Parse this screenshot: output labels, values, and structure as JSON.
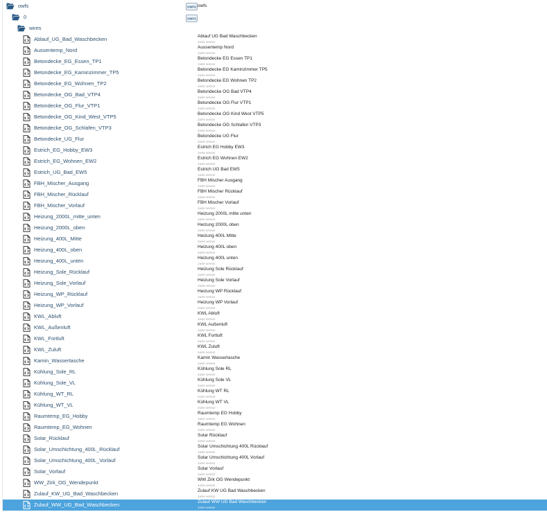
{
  "tree": {
    "root": {
      "label": "owfs",
      "description": "owfs",
      "logo_text": "OWFS"
    },
    "bus": {
      "label": "0",
      "logo_text": "OWFS"
    },
    "folder": {
      "label": "wires"
    },
    "sensor_type": "1wire sensor",
    "selected_index": 42,
    "sensors": [
      {
        "name": "Ablauf_UG_Bad_Waschbecken",
        "description": "Ablauf UG Bad Waschbecken"
      },
      {
        "name": "Aussentemp_Nord",
        "description": "Aussentemp Nord"
      },
      {
        "name": "Betondecke_EG_Essen_TP1",
        "description": "Betondecke EG Essen TP1"
      },
      {
        "name": "Betondecke_EG_Kaminzimmer_TP5",
        "description": "Betondecke EG Kaminzimmer TP5"
      },
      {
        "name": "Betondecke_EG_Wohnen_TP2",
        "description": "Betondecke EG Wohnen TP2"
      },
      {
        "name": "Betondecke_OG_Bad_VTP4",
        "description": "Betondecke OG Bad VTP4"
      },
      {
        "name": "Betondecke_OG_Flur_VTP1",
        "description": "Betondecke OG Flur VTP1"
      },
      {
        "name": "Betondecke_OG_Kind_West_VTP5",
        "description": "Betondecke OG Kind West VTP5"
      },
      {
        "name": "Betondecke_OG_Schlafen_VTP3",
        "description": "Betondecke OG Schlafen VTP3"
      },
      {
        "name": "Betondecke_UG_Flur",
        "description": "Betondecke UG Flur"
      },
      {
        "name": "Estrich_EG_Hobby_EW3",
        "description": "Estrich EG Hobby EW3"
      },
      {
        "name": "Estrich_EG_Wohnen_EW2",
        "description": "Estrich EG Wohnen EW2"
      },
      {
        "name": "Estrich_UG_Bad_EW5",
        "description": "Estrich UG Bad EW5"
      },
      {
        "name": "FBH_Mischer_Ausgang",
        "description": "FBH Mischer Ausgang"
      },
      {
        "name": "FBH_Mischer_Rücklauf",
        "description": "FBH Mischer Rücklauf"
      },
      {
        "name": "FBH_Mischer_Vorlauf",
        "description": "FBH Mischer Vorlauf"
      },
      {
        "name": "Heizung_2000L_mitte_unten",
        "description": "Heizung 2000L mitte unten"
      },
      {
        "name": "Heizung_2000L_oben",
        "description": "Heizung 2000L oben"
      },
      {
        "name": "Heizung_400L_Mitte",
        "description": "Heizung 400L Mitte"
      },
      {
        "name": "Heizung_400L_oben",
        "description": "Heizung 400L oben"
      },
      {
        "name": "Heizung_400L_unten",
        "description": "Heizung 400L unten"
      },
      {
        "name": "Heizung_Sole_Rücklauf",
        "description": "Heizung Sole Rücklauf"
      },
      {
        "name": "Heizung_Sole_Vorlauf",
        "description": "Heizung Sole Vorlauf"
      },
      {
        "name": "Heizung_WP_Rücklauf",
        "description": "Heizung WP Rücklauf"
      },
      {
        "name": "Heizung_WP_Vorlauf",
        "description": "Heizung WP Vorlauf"
      },
      {
        "name": "KWL_Abluft",
        "description": "KWL Abluft"
      },
      {
        "name": "KWL_Außenluft",
        "description": "KWL Außenluft"
      },
      {
        "name": "KWL_Fortluft",
        "description": "KWL Fortluft"
      },
      {
        "name": "KWL_Zuluft",
        "description": "KWL Zuluft"
      },
      {
        "name": "Kamin_Wassertasche",
        "description": "Kamin Wassertasche"
      },
      {
        "name": "Kühlung_Sole_RL",
        "description": "Kühlung Sole RL"
      },
      {
        "name": "Kühlung_Sole_VL",
        "description": "Kühlung Sole VL"
      },
      {
        "name": "Kühlung_WT_RL",
        "description": "Kühlung WT RL"
      },
      {
        "name": "Kühlung_WT_VL",
        "description": "Kühlung WT VL"
      },
      {
        "name": "Raumtemp_EG_Hobby",
        "description": "Raumtemp EG Hobby"
      },
      {
        "name": "Raumtemp_EG_Wohnen",
        "description": "Raumtemp EG Wohnen"
      },
      {
        "name": "Solar_Rücklauf",
        "description": "Solar Rücklauf"
      },
      {
        "name": "Solar_Umschichtung_400L_Rücklauf",
        "description": "Solar Umschichtung 400L Rücklauf"
      },
      {
        "name": "Solar_Umschichtung_400L_Vorlauf",
        "description": "Solar Umschichtung 400L Vorlauf"
      },
      {
        "name": "Solar_Vorlauf",
        "description": "Solar Vorlauf"
      },
      {
        "name": "WW_Zirk_OG_Wendepunkt",
        "description": "WW Zirk OG Wendepunkt"
      },
      {
        "name": "Zulauf_KW_UG_Bad_Waschbecken",
        "description": "Zulauf KW UG Bad Waschbecken"
      },
      {
        "name": "Zulauf_WW_UG_Bad_Waschbecken",
        "description": "Zulauf WW UG Bad Waschbecken"
      }
    ]
  },
  "colors": {
    "folder_icon": "#2b5a85",
    "file_icon": "#3a3a3a",
    "selection": "#4da3dd",
    "label_text": "#2d4f6d"
  },
  "icons": {
    "open_folder": "folder-open-icon",
    "file": "file-code-icon",
    "logo": "owfs-logo-icon"
  }
}
